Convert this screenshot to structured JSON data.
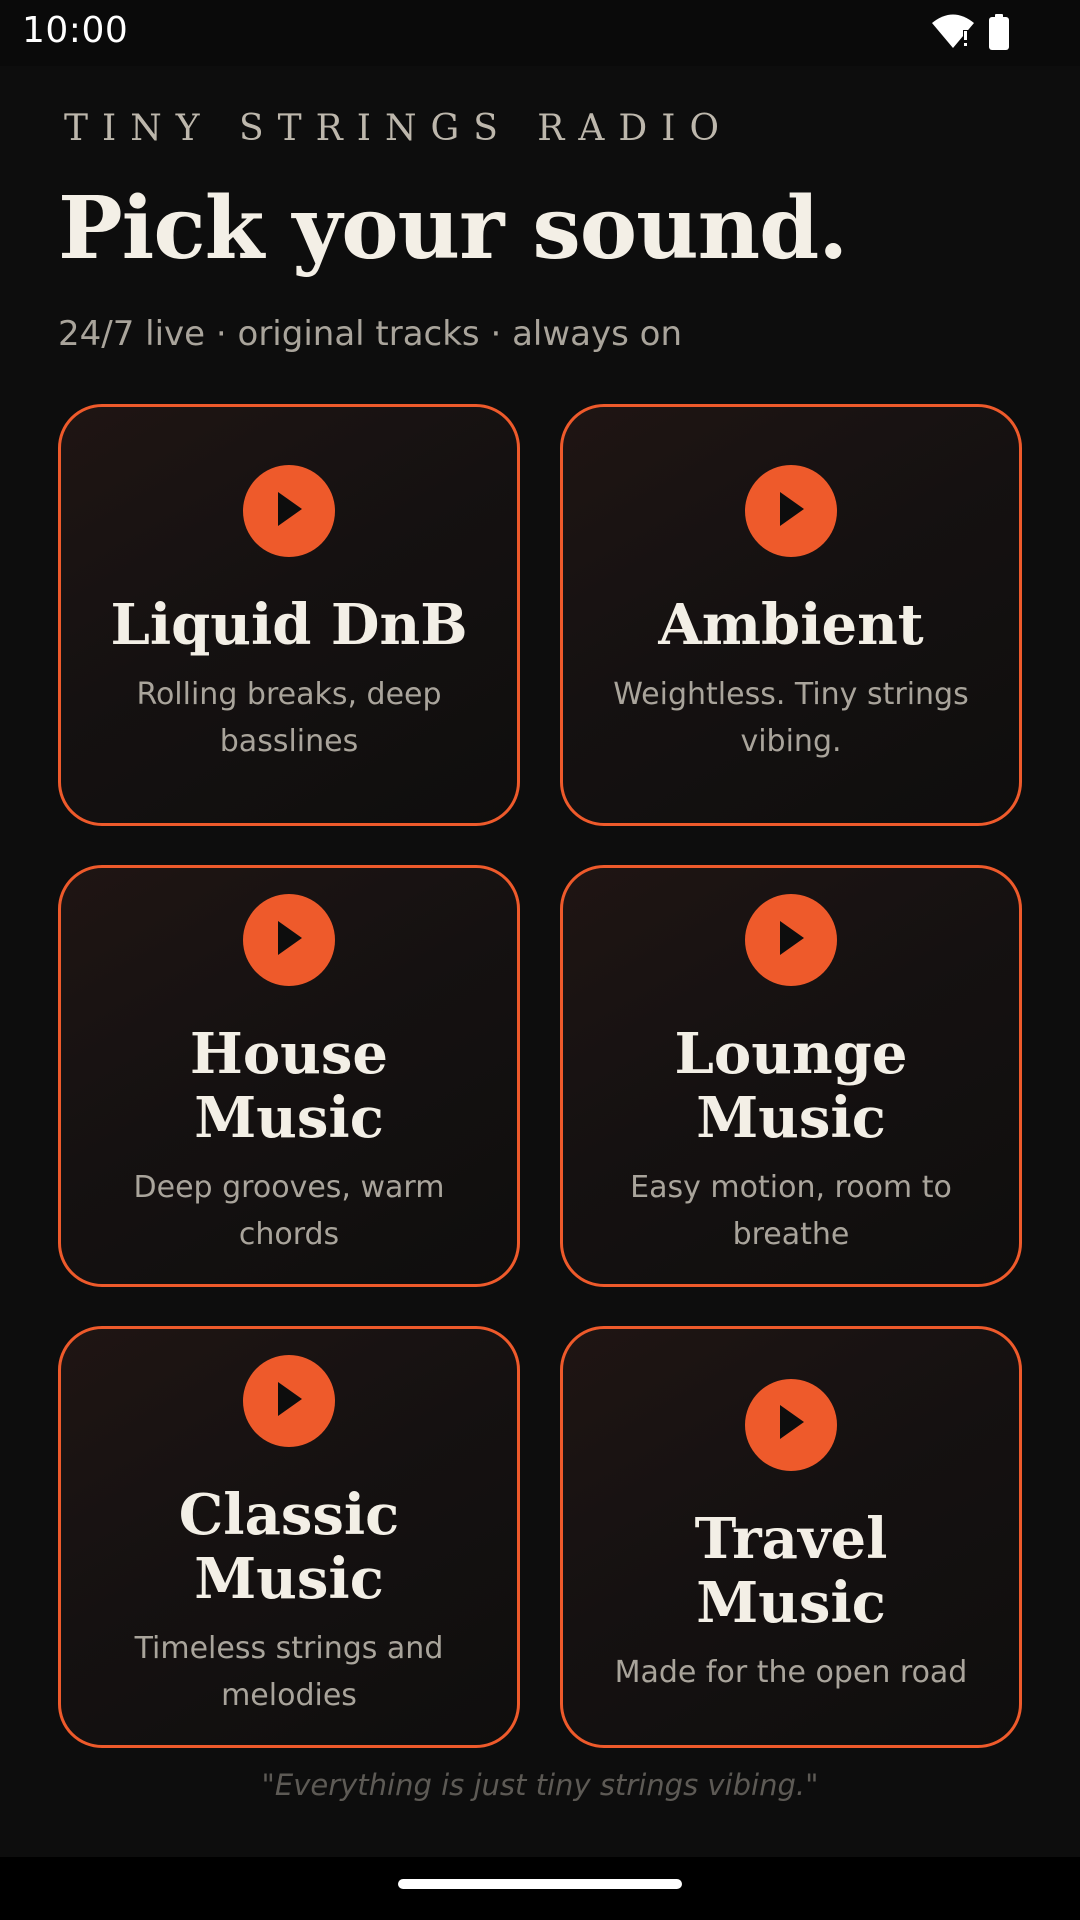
{
  "status_bar": {
    "time": "10:00",
    "icons": [
      "wifi-icon",
      "battery-icon"
    ]
  },
  "header": {
    "eyebrow": "TINY STRINGS RADIO",
    "title": "Pick your sound.",
    "subtitle": "24/7 live · original tracks · always on"
  },
  "stations": [
    {
      "title": "Liquid DnB",
      "description": "Rolling breaks, deep basslines",
      "icon": "play-icon"
    },
    {
      "title": "Ambient",
      "description": "Weightless. Tiny strings vibing.",
      "icon": "play-icon"
    },
    {
      "title": "House Music",
      "description": "Deep grooves, warm chords",
      "icon": "play-icon"
    },
    {
      "title": "Lounge Music",
      "description": "Easy motion, room to breathe",
      "icon": "play-icon"
    },
    {
      "title": "Classic Music",
      "description": "Timeless strings and melodies",
      "icon": "play-icon"
    },
    {
      "title": "Travel Music",
      "description": "Made for the open road",
      "icon": "play-icon"
    }
  ],
  "footer": {
    "quote": "\"Everything is just tiny strings vibing.\""
  },
  "colors": {
    "background": "#0d0d0d",
    "accent": "#ee5a2b",
    "text_primary": "#f3efe6",
    "text_secondary": "#a9a49b",
    "quote": "#5d5a55"
  }
}
